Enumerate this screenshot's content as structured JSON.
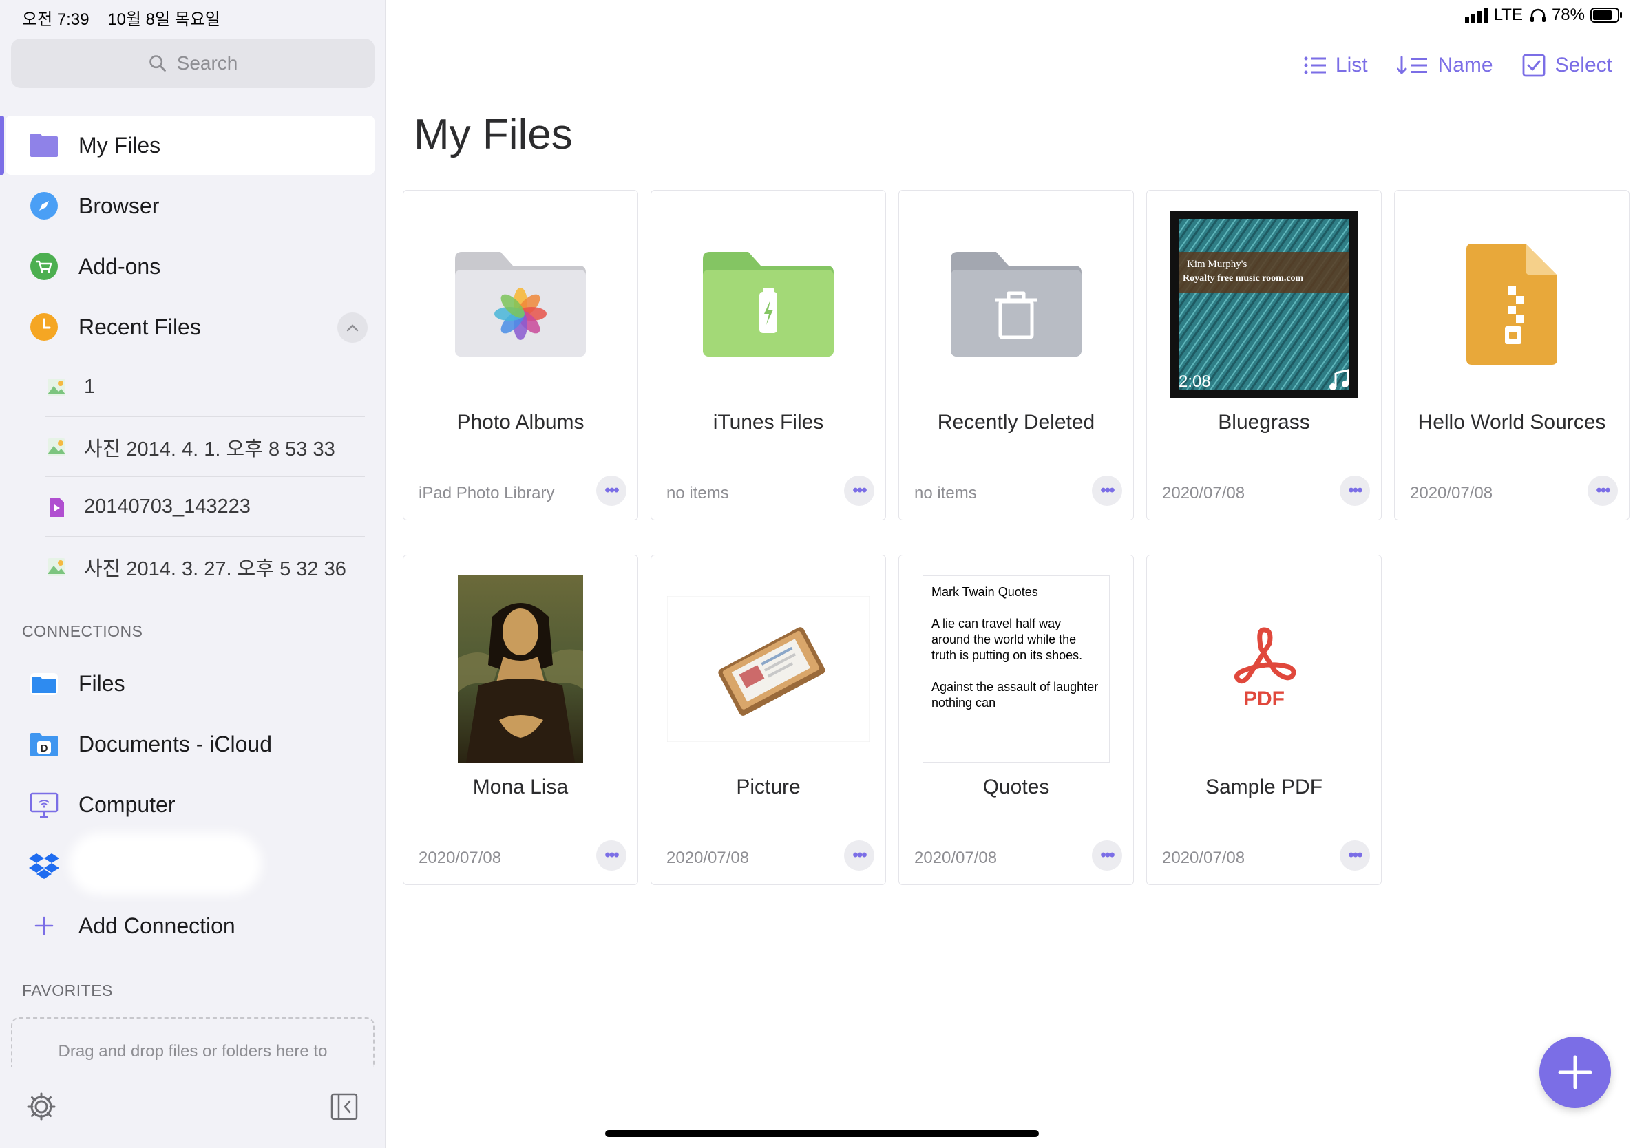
{
  "status": {
    "time": "오전 7:39",
    "date": "10월 8일 목요일",
    "network": "LTE",
    "battery": "78%"
  },
  "search": {
    "placeholder": "Search"
  },
  "sidebar": {
    "nav": [
      {
        "label": "My Files"
      },
      {
        "label": "Browser"
      },
      {
        "label": "Add-ons"
      },
      {
        "label": "Recent Files"
      }
    ],
    "recent": [
      {
        "label": "1"
      },
      {
        "label": "사진 2014. 4. 1. 오후 8 53 33"
      },
      {
        "label": "20140703_143223"
      },
      {
        "label": "사진 2014. 3. 27. 오후 5 32 36"
      }
    ],
    "connections_label": "CONNECTIONS",
    "connections": [
      {
        "label": "Files"
      },
      {
        "label": "Documents - iCloud"
      },
      {
        "label": "Computer"
      },
      {
        "label": ""
      },
      {
        "label": "Add Connection"
      }
    ],
    "favorites_label": "FAVORITES",
    "favorites_hint": "Drag and drop files or folders here to"
  },
  "toolbar": {
    "list": "List",
    "sort": "Name",
    "select": "Select"
  },
  "main": {
    "title": "My Files",
    "items": [
      {
        "name": "Photo Albums",
        "meta": "iPad Photo Library"
      },
      {
        "name": "iTunes Files",
        "meta": "no items"
      },
      {
        "name": "Recently Deleted",
        "meta": "no items"
      },
      {
        "name": "Bluegrass",
        "meta": "2020/07/08",
        "duration": "2:08",
        "art_line1": "Kim Murphy's",
        "art_line2": "Royalty free music room.com"
      },
      {
        "name": "Hello World Sources",
        "meta": "2020/07/08"
      },
      {
        "name": "Mona Lisa",
        "meta": "2020/07/08"
      },
      {
        "name": "Picture",
        "meta": "2020/07/08"
      },
      {
        "name": "Quotes",
        "meta": "2020/07/08",
        "preview_title": "Mark Twain Quotes",
        "preview_p1": "A lie can travel half way around the world while the truth is putting on its shoes.",
        "preview_p2": "Against the assault of laughter nothing can"
      },
      {
        "name": "Sample PDF",
        "meta": "2020/07/08",
        "badge": "PDF"
      }
    ]
  },
  "colors": {
    "accent": "#7b6ee6",
    "sidebar_bg": "#f2f2f7"
  }
}
